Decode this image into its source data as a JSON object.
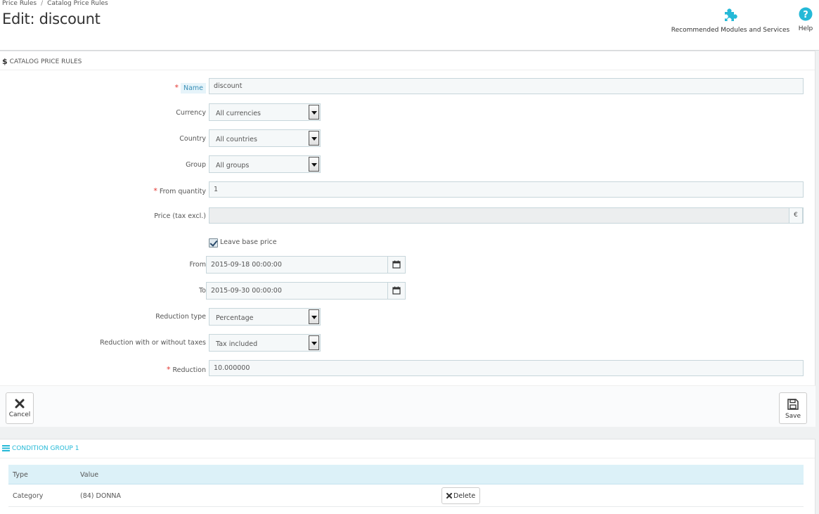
{
  "breadcrumb": [
    "Price Rules",
    "Catalog Price Rules"
  ],
  "page_title": "Edit: discount",
  "toolbar": {
    "modules_label": "Recommended Modules and Services",
    "help_label": "Help"
  },
  "panel": {
    "heading": "CATALOG PRICE RULES",
    "fields": {
      "name_label": "Name",
      "name_value": "discount",
      "currency_label": "Currency",
      "currency_value": "All currencies",
      "country_label": "Country",
      "country_value": "All countries",
      "group_label": "Group",
      "group_value": "All groups",
      "from_qty_label": "From quantity",
      "from_qty_value": "1",
      "price_label": "Price (tax excl.)",
      "price_value": "",
      "price_currency": "€",
      "leave_base_label": "Leave base price",
      "leave_base_checked": true,
      "from_label": "From",
      "from_value": "2015-09-18 00:00:00",
      "to_label": "To",
      "to_value": "2015-09-30 00:00:00",
      "reduction_type_label": "Reduction type",
      "reduction_type_value": "Percentage",
      "reduction_tax_label": "Reduction with or without taxes",
      "reduction_tax_value": "Tax included",
      "reduction_label": "Reduction",
      "reduction_value": "10.000000"
    },
    "cancel_label": "Cancel",
    "save_label": "Save"
  },
  "condition_group": {
    "heading": "CONDITION GROUP 1",
    "columns": [
      "Type",
      "Value"
    ],
    "rows": [
      {
        "type": "Category",
        "value": "(84) DONNA"
      }
    ],
    "delete_label": "Delete"
  },
  "colors": {
    "accent": "#25b9d7",
    "required": "#e3342f",
    "table_header": "#dcf1f8"
  }
}
